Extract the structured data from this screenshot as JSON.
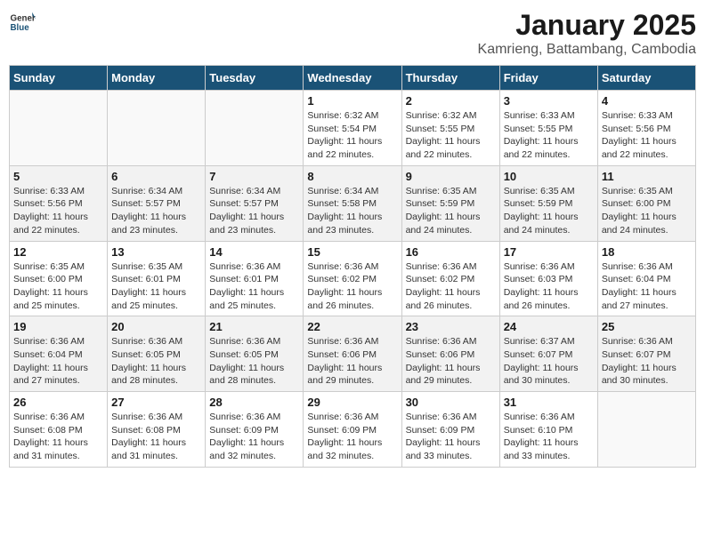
{
  "header": {
    "logo_general": "General",
    "logo_blue": "Blue",
    "month": "January 2025",
    "location": "Kamrieng, Battambang, Cambodia"
  },
  "weekdays": [
    "Sunday",
    "Monday",
    "Tuesday",
    "Wednesday",
    "Thursday",
    "Friday",
    "Saturday"
  ],
  "weeks": [
    {
      "shaded": false,
      "days": [
        {
          "date": "",
          "info": ""
        },
        {
          "date": "",
          "info": ""
        },
        {
          "date": "",
          "info": ""
        },
        {
          "date": "1",
          "info": "Sunrise: 6:32 AM\nSunset: 5:54 PM\nDaylight: 11 hours and 22 minutes."
        },
        {
          "date": "2",
          "info": "Sunrise: 6:32 AM\nSunset: 5:55 PM\nDaylight: 11 hours and 22 minutes."
        },
        {
          "date": "3",
          "info": "Sunrise: 6:33 AM\nSunset: 5:55 PM\nDaylight: 11 hours and 22 minutes."
        },
        {
          "date": "4",
          "info": "Sunrise: 6:33 AM\nSunset: 5:56 PM\nDaylight: 11 hours and 22 minutes."
        }
      ]
    },
    {
      "shaded": true,
      "days": [
        {
          "date": "5",
          "info": "Sunrise: 6:33 AM\nSunset: 5:56 PM\nDaylight: 11 hours and 22 minutes."
        },
        {
          "date": "6",
          "info": "Sunrise: 6:34 AM\nSunset: 5:57 PM\nDaylight: 11 hours and 23 minutes."
        },
        {
          "date": "7",
          "info": "Sunrise: 6:34 AM\nSunset: 5:57 PM\nDaylight: 11 hours and 23 minutes."
        },
        {
          "date": "8",
          "info": "Sunrise: 6:34 AM\nSunset: 5:58 PM\nDaylight: 11 hours and 23 minutes."
        },
        {
          "date": "9",
          "info": "Sunrise: 6:35 AM\nSunset: 5:59 PM\nDaylight: 11 hours and 24 minutes."
        },
        {
          "date": "10",
          "info": "Sunrise: 6:35 AM\nSunset: 5:59 PM\nDaylight: 11 hours and 24 minutes."
        },
        {
          "date": "11",
          "info": "Sunrise: 6:35 AM\nSunset: 6:00 PM\nDaylight: 11 hours and 24 minutes."
        }
      ]
    },
    {
      "shaded": false,
      "days": [
        {
          "date": "12",
          "info": "Sunrise: 6:35 AM\nSunset: 6:00 PM\nDaylight: 11 hours and 25 minutes."
        },
        {
          "date": "13",
          "info": "Sunrise: 6:35 AM\nSunset: 6:01 PM\nDaylight: 11 hours and 25 minutes."
        },
        {
          "date": "14",
          "info": "Sunrise: 6:36 AM\nSunset: 6:01 PM\nDaylight: 11 hours and 25 minutes."
        },
        {
          "date": "15",
          "info": "Sunrise: 6:36 AM\nSunset: 6:02 PM\nDaylight: 11 hours and 26 minutes."
        },
        {
          "date": "16",
          "info": "Sunrise: 6:36 AM\nSunset: 6:02 PM\nDaylight: 11 hours and 26 minutes."
        },
        {
          "date": "17",
          "info": "Sunrise: 6:36 AM\nSunset: 6:03 PM\nDaylight: 11 hours and 26 minutes."
        },
        {
          "date": "18",
          "info": "Sunrise: 6:36 AM\nSunset: 6:04 PM\nDaylight: 11 hours and 27 minutes."
        }
      ]
    },
    {
      "shaded": true,
      "days": [
        {
          "date": "19",
          "info": "Sunrise: 6:36 AM\nSunset: 6:04 PM\nDaylight: 11 hours and 27 minutes."
        },
        {
          "date": "20",
          "info": "Sunrise: 6:36 AM\nSunset: 6:05 PM\nDaylight: 11 hours and 28 minutes."
        },
        {
          "date": "21",
          "info": "Sunrise: 6:36 AM\nSunset: 6:05 PM\nDaylight: 11 hours and 28 minutes."
        },
        {
          "date": "22",
          "info": "Sunrise: 6:36 AM\nSunset: 6:06 PM\nDaylight: 11 hours and 29 minutes."
        },
        {
          "date": "23",
          "info": "Sunrise: 6:36 AM\nSunset: 6:06 PM\nDaylight: 11 hours and 29 minutes."
        },
        {
          "date": "24",
          "info": "Sunrise: 6:37 AM\nSunset: 6:07 PM\nDaylight: 11 hours and 30 minutes."
        },
        {
          "date": "25",
          "info": "Sunrise: 6:36 AM\nSunset: 6:07 PM\nDaylight: 11 hours and 30 minutes."
        }
      ]
    },
    {
      "shaded": false,
      "days": [
        {
          "date": "26",
          "info": "Sunrise: 6:36 AM\nSunset: 6:08 PM\nDaylight: 11 hours and 31 minutes."
        },
        {
          "date": "27",
          "info": "Sunrise: 6:36 AM\nSunset: 6:08 PM\nDaylight: 11 hours and 31 minutes."
        },
        {
          "date": "28",
          "info": "Sunrise: 6:36 AM\nSunset: 6:09 PM\nDaylight: 11 hours and 32 minutes."
        },
        {
          "date": "29",
          "info": "Sunrise: 6:36 AM\nSunset: 6:09 PM\nDaylight: 11 hours and 32 minutes."
        },
        {
          "date": "30",
          "info": "Sunrise: 6:36 AM\nSunset: 6:09 PM\nDaylight: 11 hours and 33 minutes."
        },
        {
          "date": "31",
          "info": "Sunrise: 6:36 AM\nSunset: 6:10 PM\nDaylight: 11 hours and 33 minutes."
        },
        {
          "date": "",
          "info": ""
        }
      ]
    }
  ]
}
